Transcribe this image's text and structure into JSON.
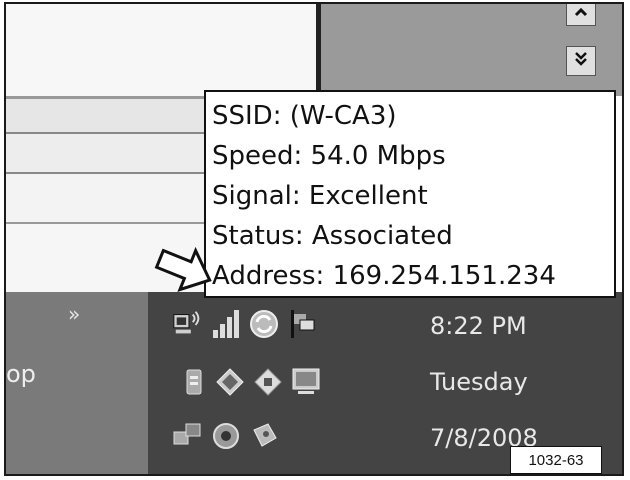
{
  "tooltip": {
    "ssid": "SSID: (W-CA3)",
    "speed": "Speed: 54.0 Mbps",
    "signal": "Signal: Excellent",
    "status": "Status: Associated",
    "address": "Address: 169.254.151.234"
  },
  "taskbar": {
    "chevron": "»",
    "label": "op"
  },
  "tray_icons": [
    "wireless-network-icon",
    "signal-strength-icon",
    "sync-icon",
    "flag-icon",
    "battery-icon",
    "shield-icon",
    "diamond-icon",
    "display-icon",
    "network-computers-icon",
    "speaker-icon",
    "security-tag-icon"
  ],
  "clock": {
    "time": "8:22 PM",
    "day": "Tuesday",
    "date": "7/8/2008"
  },
  "scroll": {
    "up_glyph": "⌃",
    "down_glyph": "⏬"
  },
  "figure": {
    "reference": "1032-63"
  }
}
